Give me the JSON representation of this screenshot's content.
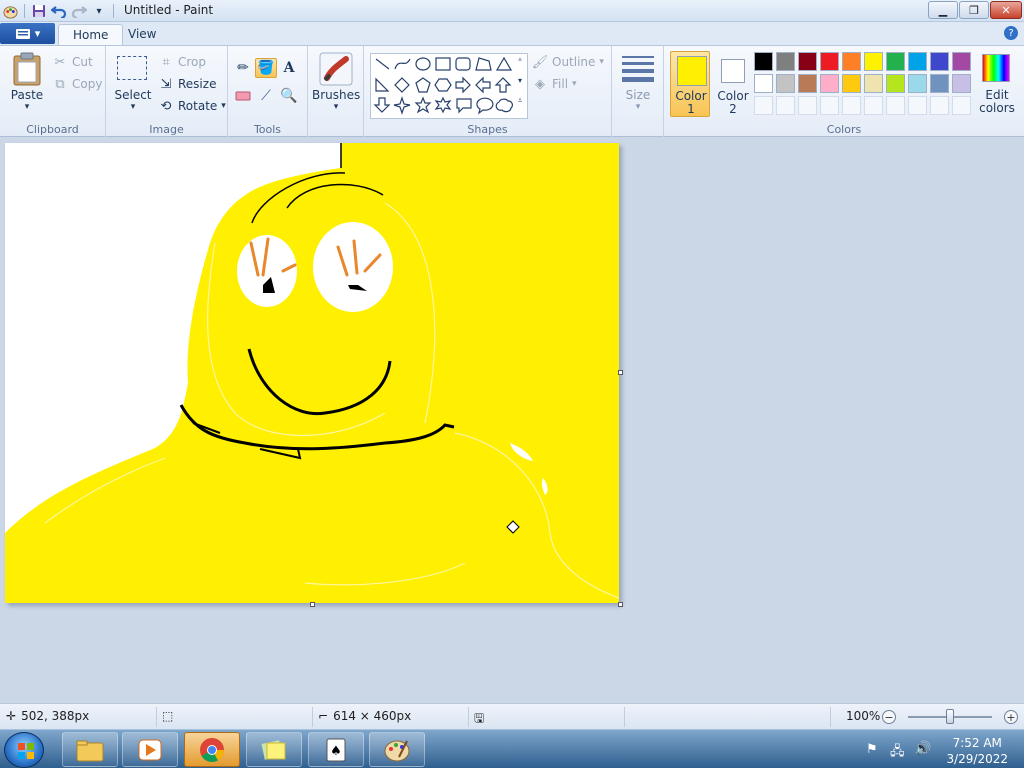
{
  "window": {
    "title": "Untitled - Paint"
  },
  "tabs": [
    {
      "label": "Home",
      "active": true
    },
    {
      "label": "View",
      "active": false
    }
  ],
  "clipboard": {
    "paste": "Paste",
    "cut": "Cut",
    "copy": "Copy",
    "group": "Clipboard"
  },
  "image": {
    "select": "Select",
    "crop": "Crop",
    "resize": "Resize",
    "rotate": "Rotate",
    "group": "Image"
  },
  "tools": {
    "group": "Tools",
    "text_tool_glyph": "A"
  },
  "brushes": {
    "label": "Brushes"
  },
  "shapes": {
    "outline": "Outline",
    "fill": "Fill",
    "group": "Shapes"
  },
  "size": {
    "label": "Size"
  },
  "colors": {
    "color1_label": "Color",
    "color1_num": "1",
    "color2_label": "Color",
    "color2_num": "2",
    "color1_value": "#ffef00",
    "color2_value": "#ffffff",
    "edit_label_1": "Edit",
    "edit_label_2": "colors",
    "group": "Colors",
    "palette_row1": [
      "#000000",
      "#7f7f7f",
      "#880015",
      "#ed1c24",
      "#ff7f27",
      "#fff200",
      "#22b14c",
      "#00a2e8",
      "#3f48cc",
      "#a349a4"
    ],
    "palette_row2": [
      "#ffffff",
      "#c3c3c3",
      "#b97a57",
      "#ffaec9",
      "#ffc90e",
      "#efe4b0",
      "#b5e61d",
      "#99d9ea",
      "#7092be",
      "#c8bfe7"
    ]
  },
  "status": {
    "cursor_pos": "502, 388px",
    "canvas_size": "614 × 460px",
    "zoom": "100%",
    "zoom_level": 0.5
  },
  "taskbar": {
    "time": "7:52 AM",
    "date": "3/29/2022"
  }
}
